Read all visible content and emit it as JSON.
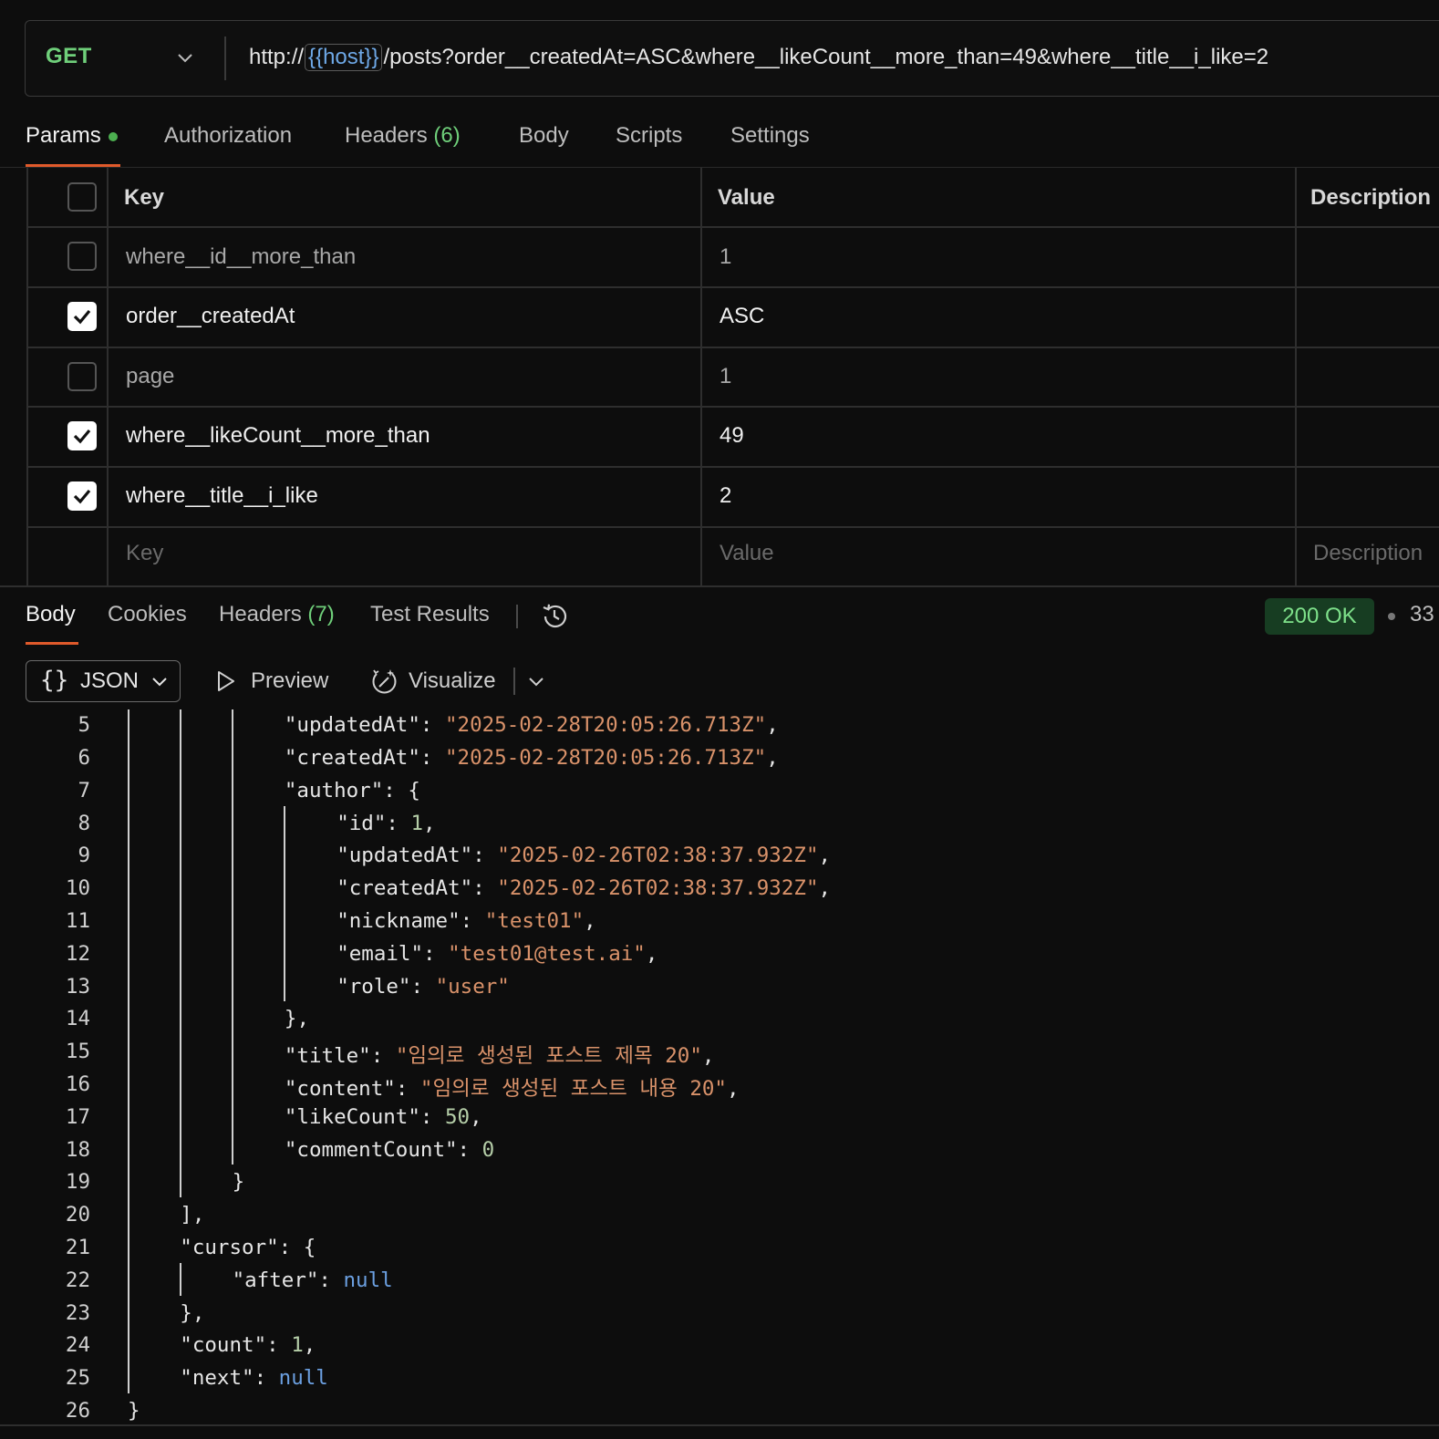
{
  "request": {
    "method": "GET",
    "url_prefix": "http://",
    "url_variable": "{{host}}",
    "url_suffix": "/posts?order__createdAt=ASC&where__likeCount__more_than=49&where__title__i_like=2"
  },
  "request_tabs": [
    {
      "label": "Params",
      "active": true,
      "dot": true
    },
    {
      "label": "Authorization"
    },
    {
      "label": "Headers",
      "count": "(6)"
    },
    {
      "label": "Body"
    },
    {
      "label": "Scripts"
    },
    {
      "label": "Settings"
    }
  ],
  "params": {
    "headers": {
      "key": "Key",
      "value": "Value",
      "description": "Description"
    },
    "rows": [
      {
        "key": "where__id__more_than",
        "value": "1",
        "checked": false
      },
      {
        "key": "order__createdAt",
        "value": "ASC",
        "checked": true
      },
      {
        "key": "page",
        "value": "1",
        "checked": false
      },
      {
        "key": "where__likeCount__more_than",
        "value": "49",
        "checked": true
      },
      {
        "key": "where__title__i_like",
        "value": "2",
        "checked": true
      }
    ],
    "new_row_placeholders": {
      "key": "Key",
      "value": "Value",
      "description": "Description"
    }
  },
  "response_tabs": [
    {
      "label": "Body",
      "active": true
    },
    {
      "label": "Cookies"
    },
    {
      "label": "Headers",
      "count": "(7)"
    },
    {
      "label": "Test Results"
    }
  ],
  "response": {
    "status": "200 OK",
    "status_color": "#7ee08a",
    "meta_partial": "33"
  },
  "format_bar": {
    "format": "JSON",
    "preview": "Preview",
    "visualize": "Visualize"
  },
  "icons": {
    "history": "history-icon",
    "preview": "play-icon",
    "visualize": "visualize-icon",
    "chevron": "chevron-down-icon"
  },
  "code": {
    "lines": [
      {
        "n": "5",
        "text": "\"updatedAt\": \"2025-02-28T20:05:26.713Z\","
      },
      {
        "n": "6",
        "text": "\"createdAt\": \"2025-02-28T20:05:26.713Z\","
      },
      {
        "n": "7",
        "text": "\"author\": {"
      },
      {
        "n": "8",
        "text": "\"id\": 1,"
      },
      {
        "n": "9",
        "text": "\"updatedAt\": \"2025-02-26T02:38:37.932Z\","
      },
      {
        "n": "10",
        "text": "\"createdAt\": \"2025-02-26T02:38:37.932Z\","
      },
      {
        "n": "11",
        "text": "\"nickname\": \"test01\","
      },
      {
        "n": "12",
        "text": "\"email\": \"test01@test.ai\","
      },
      {
        "n": "13",
        "text": "\"role\": \"user\""
      },
      {
        "n": "14",
        "text": "},"
      },
      {
        "n": "15",
        "text": "\"title\": \"임의로 생성된 포스트 제목 20\","
      },
      {
        "n": "16",
        "text": "\"content\": \"임의로 생성된 포스트 내용 20\","
      },
      {
        "n": "17",
        "text": "\"likeCount\": 50,"
      },
      {
        "n": "18",
        "text": "\"commentCount\": 0"
      },
      {
        "n": "19",
        "text": "}"
      },
      {
        "n": "20",
        "text": "],"
      },
      {
        "n": "21",
        "text": "\"cursor\": {"
      },
      {
        "n": "22",
        "text": "\"after\": null"
      },
      {
        "n": "23",
        "text": "},"
      },
      {
        "n": "24",
        "text": "\"count\": 1,"
      },
      {
        "n": "25",
        "text": "\"next\": null"
      },
      {
        "n": "26",
        "text": "}"
      }
    ]
  }
}
